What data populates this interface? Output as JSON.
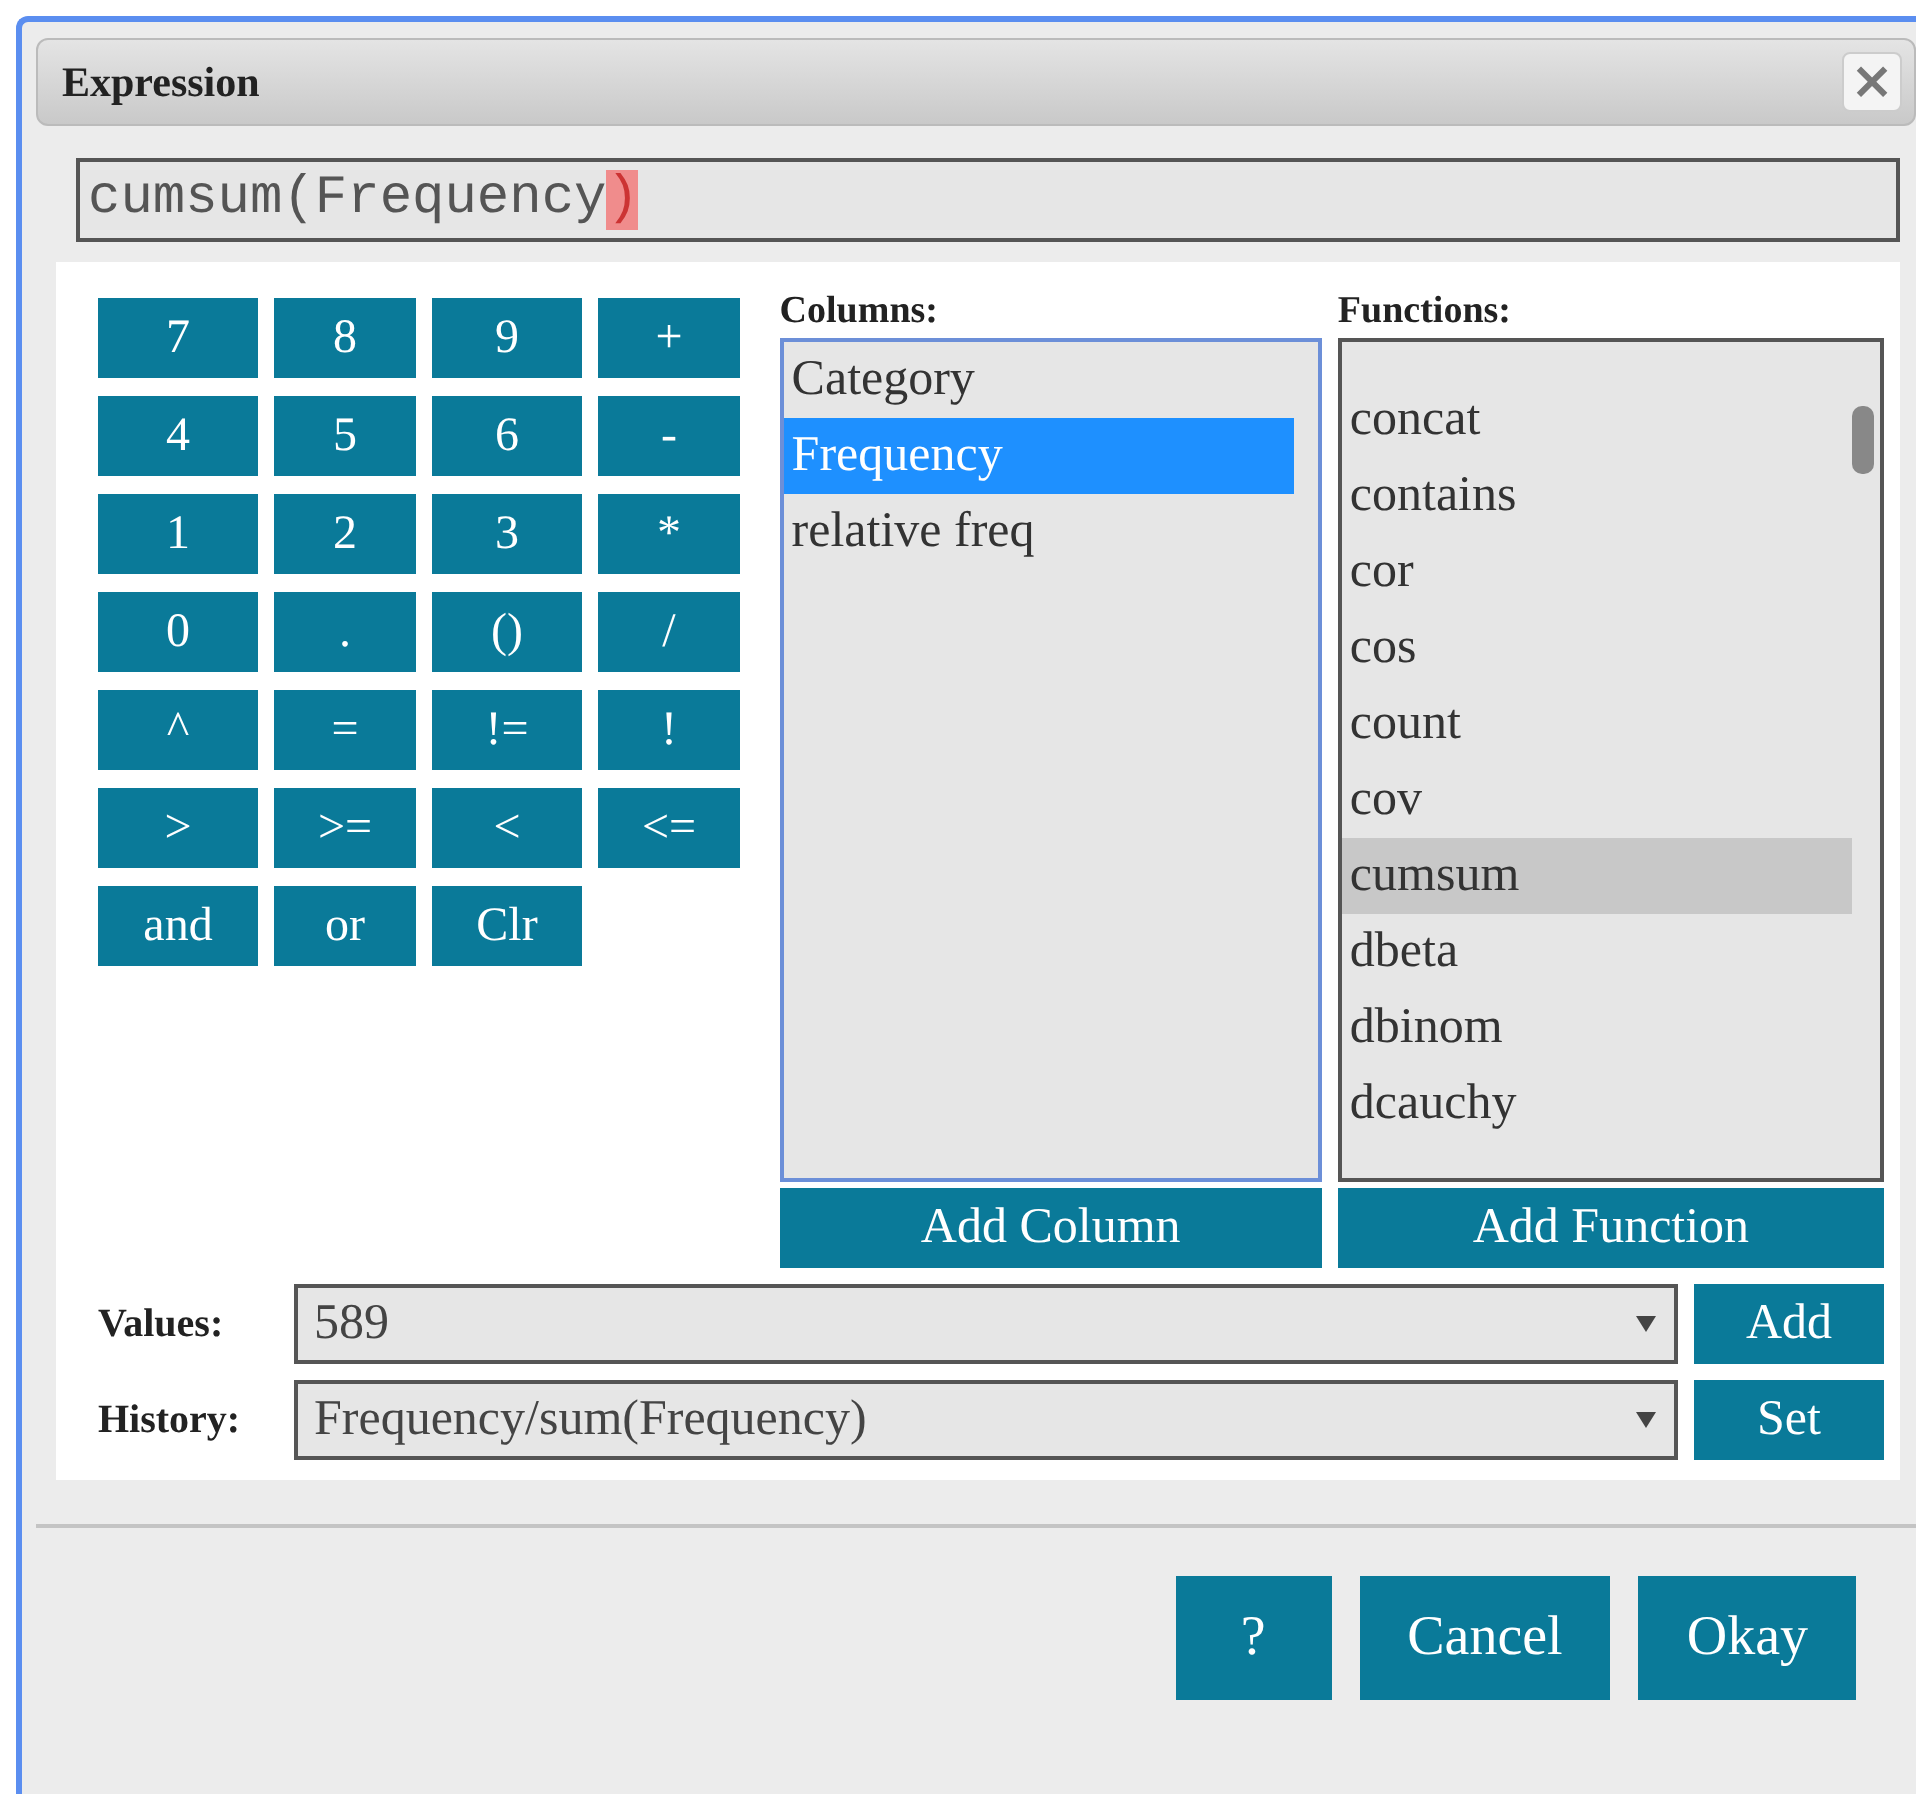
{
  "window": {
    "title": "Expression",
    "close": "×"
  },
  "expression": [
    {
      "text": "cumsum(Frequency",
      "highlighted": false
    },
    {
      "text": ")",
      "highlighted": true
    }
  ],
  "keypad": [
    "7",
    "8",
    "9",
    "+",
    "4",
    "5",
    "6",
    "-",
    "1",
    "2",
    "3",
    "*",
    "0",
    ".",
    "()",
    "/",
    "^",
    "=",
    "!=",
    "!",
    ">",
    ">=",
    "<",
    "<=",
    "and",
    "or",
    "Clr"
  ],
  "columns": {
    "label": "Columns:",
    "items": [
      {
        "text": "Category",
        "selected": false
      },
      {
        "text": "Frequency",
        "selected": true
      },
      {
        "text": "relative freq",
        "selected": false
      }
    ],
    "button": "Add Column"
  },
  "functions": {
    "label": "Functions:",
    "items": [
      {
        "text": "concat",
        "selected": false
      },
      {
        "text": "contains",
        "selected": false
      },
      {
        "text": "cor",
        "selected": false
      },
      {
        "text": "cos",
        "selected": false
      },
      {
        "text": "count",
        "selected": false
      },
      {
        "text": "cov",
        "selected": false
      },
      {
        "text": "cumsum",
        "selected": true
      },
      {
        "text": "dbeta",
        "selected": false
      },
      {
        "text": "dbinom",
        "selected": false
      },
      {
        "text": "dcauchy",
        "selected": false
      }
    ],
    "button": "Add Function"
  },
  "values": {
    "label": "Values:",
    "value": "589",
    "button": "Add"
  },
  "history": {
    "label": "History:",
    "value": "Frequency/sum(Frequency)",
    "button": "Set"
  },
  "buttons": [
    "?",
    "Cancel",
    "Okay"
  ]
}
